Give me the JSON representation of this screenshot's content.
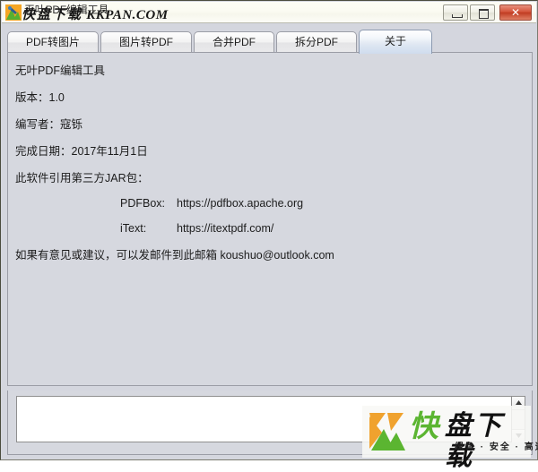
{
  "window": {
    "title": "无叶PDF编辑工具",
    "icon": "app-icon",
    "buttons": {
      "minimize": "minimize",
      "maximize": "maximize",
      "close": "✕"
    }
  },
  "watermark": {
    "title_cn": "快盘下载",
    "title_domain": "KKPAN.COM",
    "logo_kuai": "快",
    "logo_rest": "盘下载",
    "logo_slogan": "绿色 · 安全 · 高速"
  },
  "tabs": [
    {
      "label": "PDF转图片",
      "selected": false
    },
    {
      "label": "图片转PDF",
      "selected": false
    },
    {
      "label": "合并PDF",
      "selected": false
    },
    {
      "label": "拆分PDF",
      "selected": false
    },
    {
      "label": "关于",
      "selected": true
    }
  ],
  "about": {
    "app_name": "无叶PDF编辑工具",
    "version": "版本：1.0",
    "author": "编写者：寇铄",
    "finish_date": "完成日期：2017年11月1日",
    "jar_heading": "此软件引用第三方JAR包：",
    "jars": [
      {
        "name": "PDFBox:",
        "url": "https://pdfbox.apache.org"
      },
      {
        "name": "iText:",
        "url": "https://itextpdf.com/"
      }
    ],
    "contact": "如果有意见或建议，可以发邮件到此邮箱 koushuo@outlook.com"
  },
  "log": {
    "value": "",
    "placeholder": ""
  },
  "colors": {
    "window_bg": "#d4d6de",
    "panel_bg": "#d6d8df",
    "border": "#9b9da6",
    "close_button": "#c03c22",
    "tab_selected": "#cfdcee",
    "logo_green": "#5bb531",
    "logo_orange": "#f0a22e"
  }
}
